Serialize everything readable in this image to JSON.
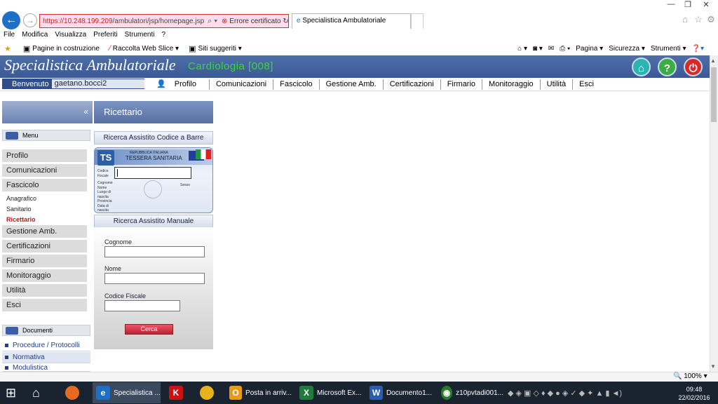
{
  "browser": {
    "url": "https://10.248.199.209/ambulatori/jsp/homepage.jsp",
    "url_host": "https://10.248.199.209",
    "url_path": "/ambulatori/jsp/homepage.jsp",
    "cert_error": "Errore certificato",
    "tab_title": "Specialistica Ambulatoriale",
    "menu": [
      "File",
      "Modifica",
      "Visualizza",
      "Preferiti",
      "Strumenti",
      "?"
    ],
    "favorites": [
      "Pagine in costruzione",
      "Raccolta Web Slice",
      "Siti suggeriti"
    ],
    "commands": [
      "Pagina",
      "Sicurezza",
      "Strumenti"
    ],
    "zoom": "100%"
  },
  "app": {
    "title": "Specialistica Ambulatoriale",
    "department": "Cardiologia [008]",
    "welcome_label": "Benvenuto",
    "username": "gaetano.bocci2",
    "topnav": [
      "Profilo",
      "Comunicazioni",
      "Fascicolo",
      "Gestione Amb.",
      "Certificazioni",
      "Firmario",
      "Monitoraggio",
      "Utilità",
      "Esci"
    ]
  },
  "sidebar": {
    "menu_label": "Menu",
    "items": [
      "Profilo",
      "Comunicazioni",
      "Fascicolo"
    ],
    "subitems": [
      "Anagrafico",
      "Sanitario",
      "Ricettario"
    ],
    "items2": [
      "Gestione Amb.",
      "Certificazioni",
      "Firmario",
      "Monitoraggio",
      "Utilità",
      "Esci"
    ],
    "documents_label": "Documenti",
    "documents": [
      "Procedure / Protocolli",
      "Normativa",
      "Modulistica"
    ]
  },
  "main": {
    "section_title": "Ricettario",
    "barcode_search": "Ricerca Assistito Codice a Barre",
    "card": {
      "republic": "REPUBBLICA ITALIANA",
      "title": "TESSERA SANITARIA",
      "fields": [
        "Codice Fiscale",
        "Cognome",
        "Nome",
        "Luogo di nascita",
        "Provincia",
        "Data di nascita"
      ],
      "sex_label": "Sesso",
      "ts_logo": "TS"
    },
    "manual_search": "Ricerca Assistito Manuale",
    "labels": {
      "surname": "Cognome",
      "name": "Nome",
      "tax_code": "Codice Fiscale"
    },
    "search_button": "Cerca"
  },
  "taskbar": {
    "items": [
      "Specialistica ...",
      "Posta in arriv...",
      "Microsoft Ex...",
      "Documento1...",
      "z10pvtadi001..."
    ],
    "time": "09:48",
    "date": "22/02/2016"
  }
}
